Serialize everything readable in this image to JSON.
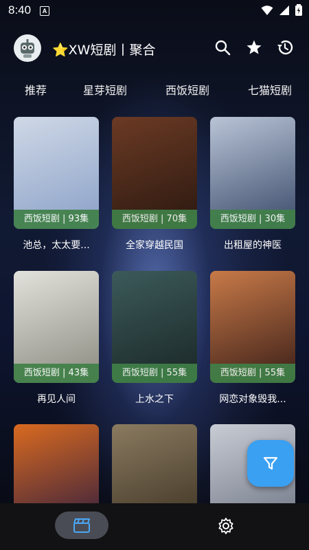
{
  "status_bar": {
    "time": "8:40",
    "notification_glyph": "A"
  },
  "header": {
    "title": "⭐XW短剧丨聚合"
  },
  "tabs": [
    {
      "label": "推荐"
    },
    {
      "label": "星芽短剧"
    },
    {
      "label": "西饭短剧"
    },
    {
      "label": "七猫短剧"
    }
  ],
  "dramas": [
    {
      "badge": "西饭短剧 | 93集",
      "title": "池总，太太要...",
      "colors": [
        "#cfd8e6",
        "#8aa0c8"
      ]
    },
    {
      "badge": "西饭短剧 | 70集",
      "title": "全家穿越民国",
      "colors": [
        "#6b3a24",
        "#2a1810"
      ]
    },
    {
      "badge": "西饭短剧 | 30集",
      "title": "出租屋的神医",
      "colors": [
        "#b9c4d6",
        "#3a4a6a"
      ]
    },
    {
      "badge": "西饭短剧 | 43集",
      "title": "再见人间",
      "colors": [
        "#e2e2dc",
        "#8a8a80"
      ]
    },
    {
      "badge": "西饭短剧 | 55集",
      "title": "上水之下",
      "colors": [
        "#3c5a5a",
        "#1a2626"
      ]
    },
    {
      "badge": "西饭短剧 | 55集",
      "title": "网恋对象毁我...",
      "colors": [
        "#c87a48",
        "#3a1e18"
      ]
    },
    {
      "badge": "",
      "title": "",
      "colors": [
        "#d96a20",
        "#2a1a40"
      ]
    },
    {
      "badge": "",
      "title": "",
      "colors": [
        "#8a7a60",
        "#3a3020"
      ]
    },
    {
      "badge": "",
      "title": "",
      "colors": [
        "#c8ccd4",
        "#6a7080"
      ]
    }
  ],
  "accent": "#3aa0f2",
  "badge_color": "#408048"
}
